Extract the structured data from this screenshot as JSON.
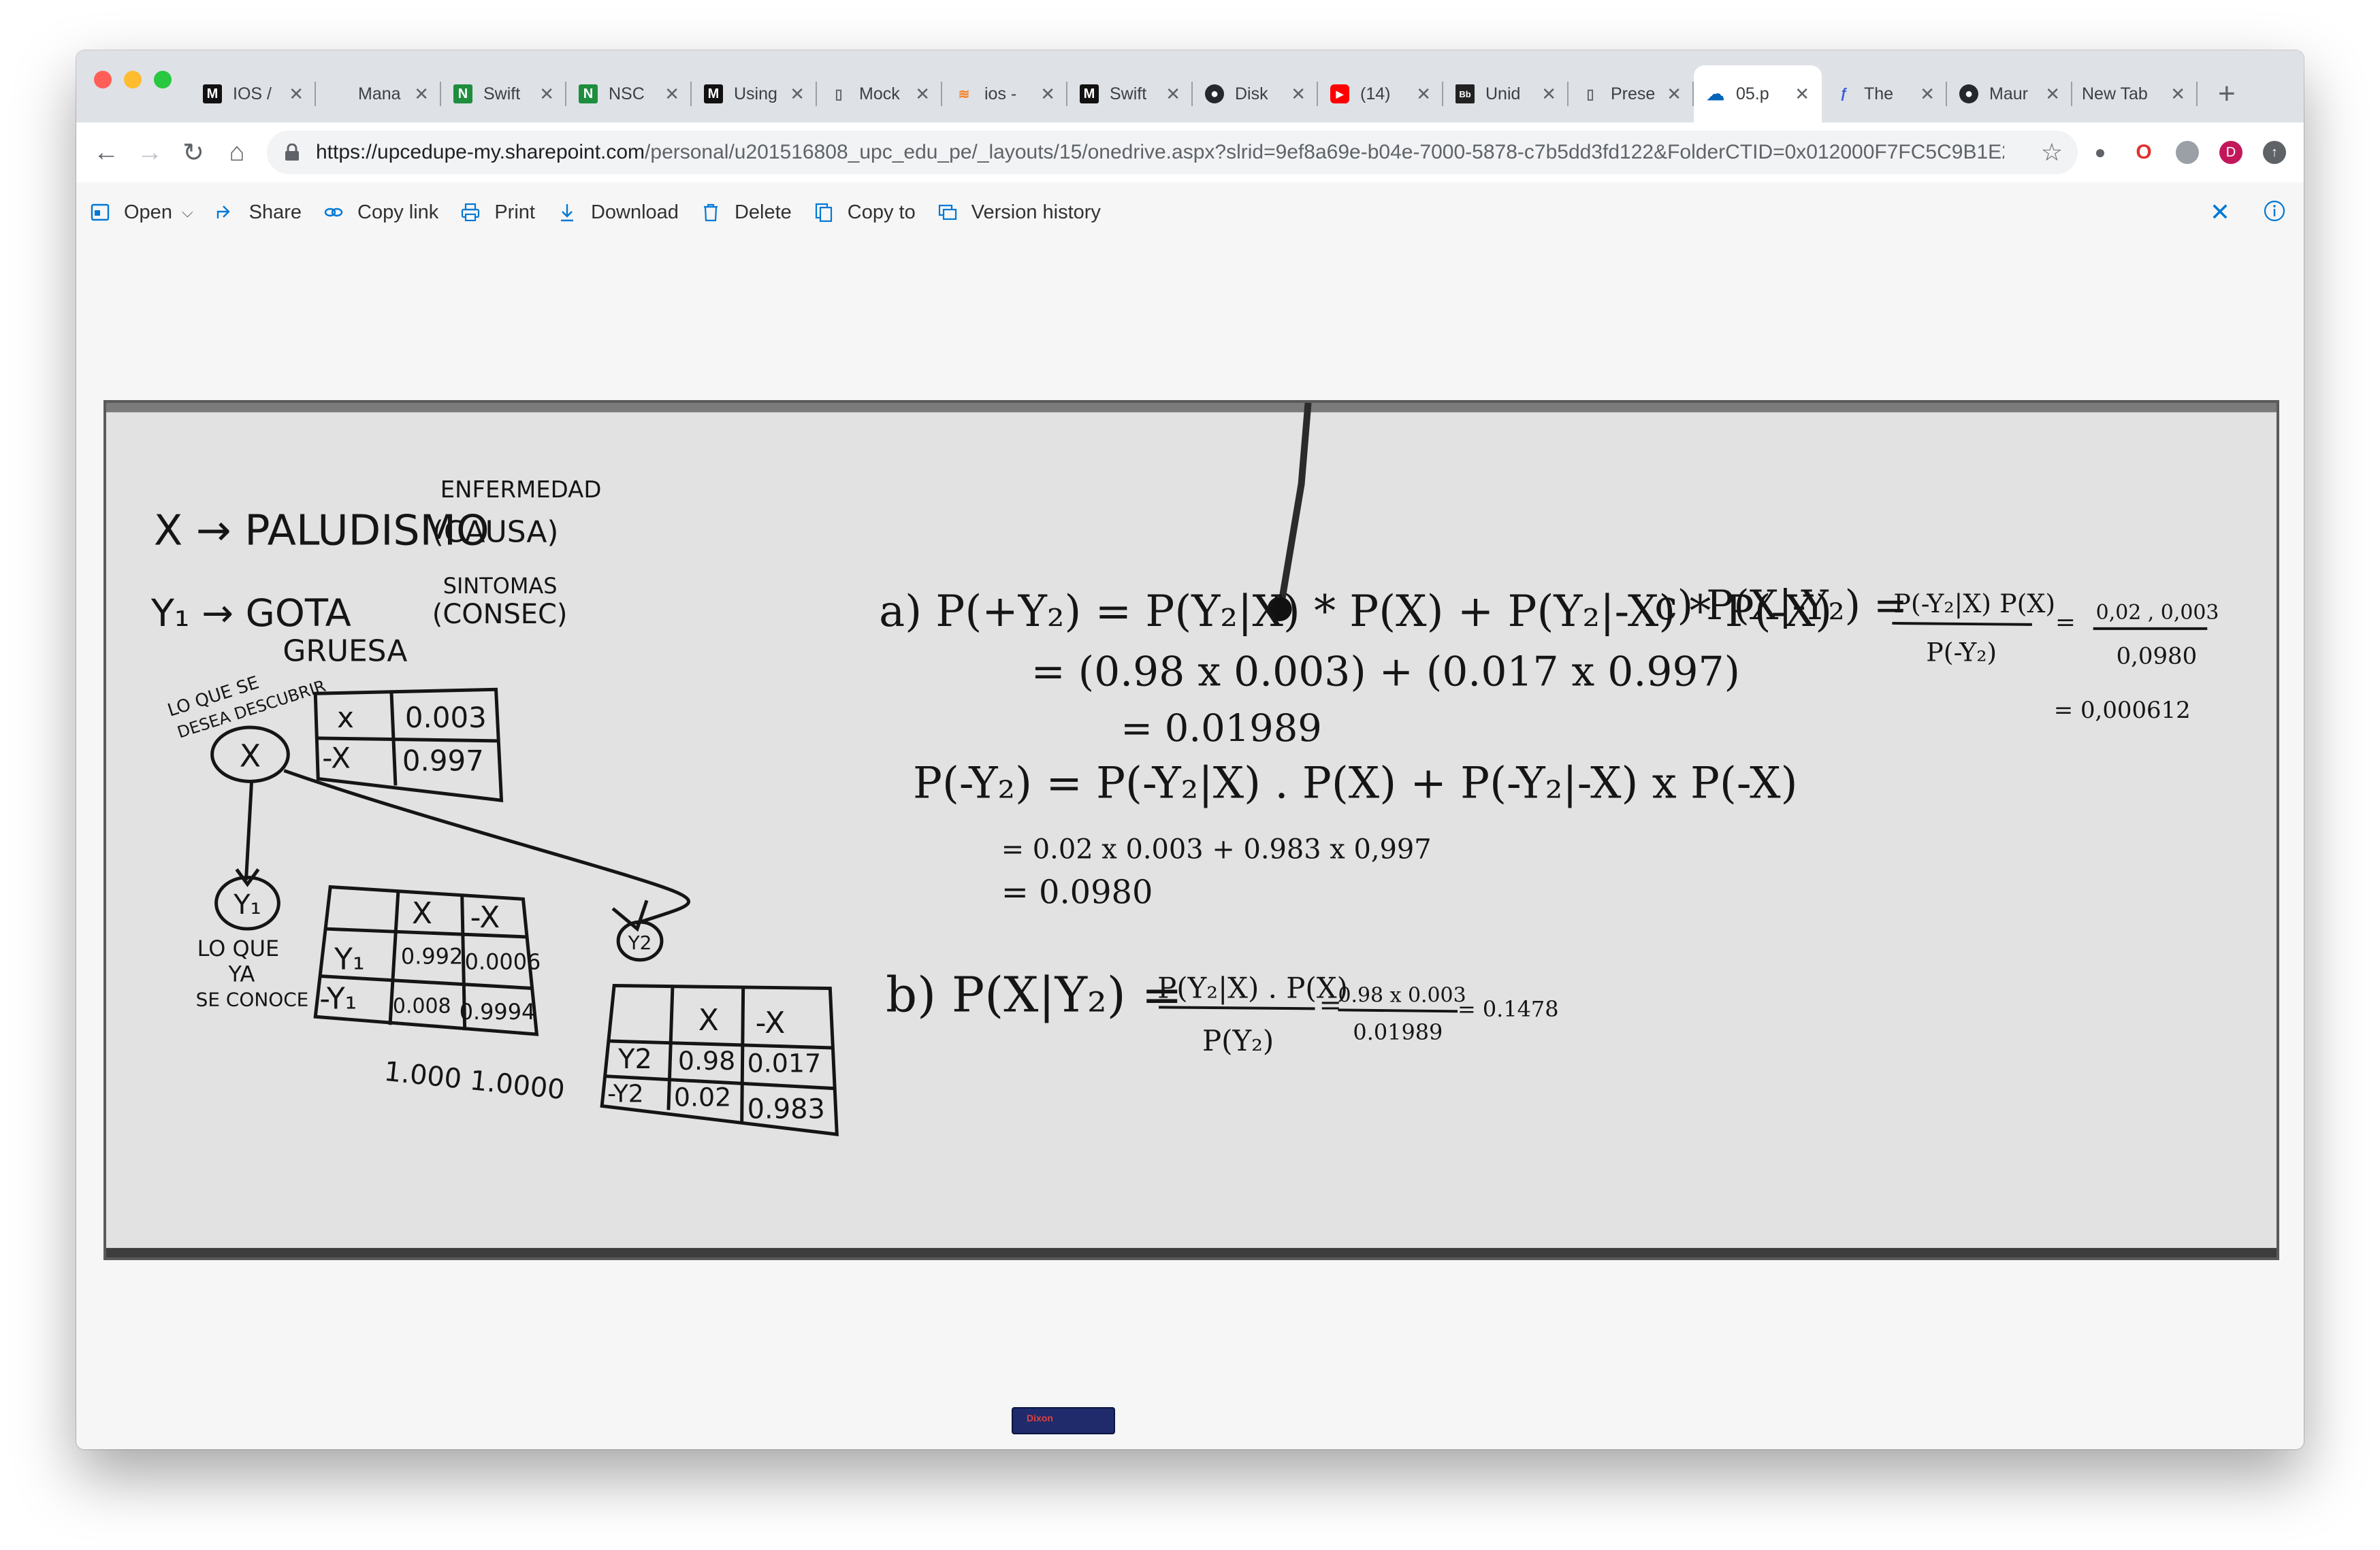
{
  "tabs": [
    {
      "title": "IOS /",
      "favicon": "medium-icon",
      "active": false
    },
    {
      "title": "Mana",
      "favicon": "apple-icon",
      "active": false
    },
    {
      "title": "Swift",
      "favicon": "swift-green-icon",
      "active": false
    },
    {
      "title": "NSC",
      "favicon": "swift-green-icon",
      "active": false
    },
    {
      "title": "Using",
      "favicon": "medium-icon",
      "active": false
    },
    {
      "title": "Mock",
      "favicon": "document-icon",
      "active": false
    },
    {
      "title": "ios -",
      "favicon": "stackoverflow-icon",
      "active": false
    },
    {
      "title": "Swift",
      "favicon": "medium-icon",
      "active": false
    },
    {
      "title": "Disk",
      "favicon": "github-icon",
      "active": false
    },
    {
      "title": "(14)",
      "favicon": "youtube-icon",
      "active": false
    },
    {
      "title": "Unid",
      "favicon": "blackboard-icon",
      "active": false
    },
    {
      "title": "Prese",
      "favicon": "document-icon",
      "active": false
    },
    {
      "title": "05.p",
      "favicon": "onedrive-icon",
      "active": true
    },
    {
      "title": "The",
      "favicon": "swiftlee-icon",
      "active": false
    },
    {
      "title": "Maur",
      "favicon": "github-icon",
      "active": false
    },
    {
      "title": "New Tab",
      "favicon": "",
      "active": false
    }
  ],
  "address": {
    "url_host": "https://upcedupe-my.sharepoint.com",
    "url_rest": "/personal/u201516808_upc_edu_pe/_layouts/15/onedrive.aspx?slrid=9ef8a69e-b04e-7000-5878-c7b5dd3fd122&FolderCTID=0x012000F7FC5C9B1E2..."
  },
  "extensions": {
    "avatar_letter": "D"
  },
  "toolbar": {
    "open": "Open",
    "share": "Share",
    "copy_link": "Copy link",
    "print": "Print",
    "download": "Download",
    "delete": "Delete",
    "copy_to": "Copy to",
    "version_history": "Version history"
  },
  "whiteboard": {
    "enfermedad": "ENFERMEDAD",
    "x_def": "X → PALUDISMO",
    "causa": "(CAUSA)",
    "sintomas": "SINTOMAS",
    "y1_def": "Y₁ →  GOTA",
    "gruesa": "GRUESA",
    "consec": "(CONSEC)",
    "lo_que_se": "LO QUE SE",
    "desea": "DESEA DESCUBRIR",
    "node_x": "X",
    "prior_table": [
      [
        "x",
        "0.003"
      ],
      [
        "-X",
        "0.997"
      ]
    ],
    "node_y1": "Y₁",
    "lo_que_ya": "LO QUE",
    "ya": "YA",
    "se_conoce": "SE CONOCE",
    "y1_table_header": [
      "",
      "X",
      "-X"
    ],
    "y1_table_rows": [
      [
        "Y₁",
        "0.992",
        "0.0006"
      ],
      [
        "-Y₁",
        "0.008",
        "0.9994"
      ]
    ],
    "y1_table_sums": "1.000 1.0000",
    "node_y2": "Y2",
    "y2_table_header": [
      "",
      "X",
      "-X"
    ],
    "y2_table_rows": [
      [
        "Y2",
        "0.98",
        "0.017"
      ],
      [
        "-Y2",
        "0.02",
        "0.983"
      ]
    ],
    "eq_a1": "a) P(+Y₂) = P(Y₂|X) * P(X) + P(Y₂|-X) * P(-X)",
    "eq_a2": "= (0.98 x 0.003) + (0.017 x 0.997)",
    "eq_a3": "= 0.01989",
    "eq_neg1": "P(-Y₂) = P(-Y₂|X) . P(X) + P(-Y₂|-X) x P(-X)",
    "eq_neg2": "= 0.02 x 0.003 + 0.983 x 0,997",
    "eq_neg3": "= 0.0980",
    "eq_b_lhs": "b) P(X|Y₂) =",
    "eq_b_num": "P(Y₂|X) . P(X)",
    "eq_b_den": "P(Y₂)",
    "eq_b_num2": "0.98 x 0.003",
    "eq_b_den2": "0.01989",
    "eq_b_res": "= 0.1478",
    "eq_c_lhs": "c) P(X|-Y₂) =",
    "eq_c_num": "P(-Y₂|X) P(X)",
    "eq_c_den": "P(-Y₂)",
    "eq_c_num2": "0,02 , 0,003",
    "eq_c_den2": "0,0980",
    "eq_c_res": "= 0,000612",
    "eraser_label": "Dixon"
  }
}
